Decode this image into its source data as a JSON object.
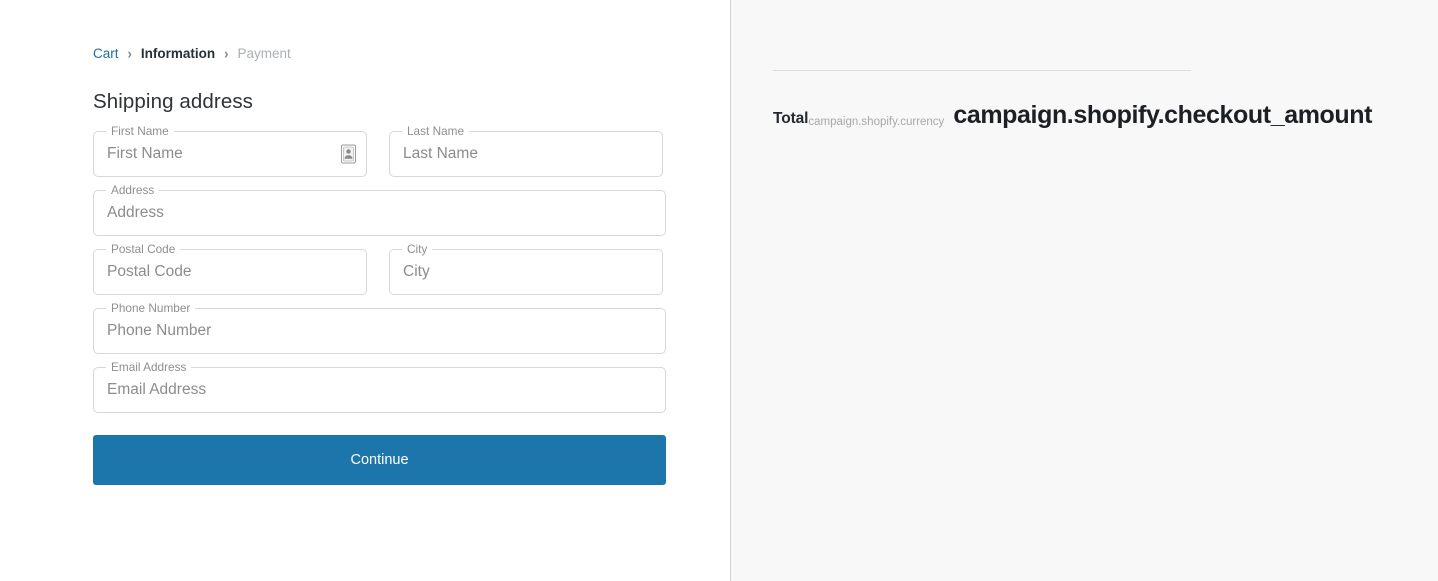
{
  "breadcrumb": {
    "separator": "›",
    "items": [
      {
        "label": "Cart",
        "state": "link"
      },
      {
        "label": "Information",
        "state": "active"
      },
      {
        "label": "Payment",
        "state": "inactive"
      }
    ]
  },
  "form": {
    "title": "Shipping address",
    "fields": [
      {
        "name": "first-name",
        "label": "First Name",
        "placeholder": "First Name",
        "value": "",
        "has_autofill_icon": true
      },
      {
        "name": "last-name",
        "label": "Last Name",
        "placeholder": "Last Name",
        "value": "",
        "has_autofill_icon": false
      },
      {
        "name": "address",
        "label": "Address",
        "placeholder": "Address",
        "value": "",
        "has_autofill_icon": false
      },
      {
        "name": "postal-code",
        "label": "Postal Code",
        "placeholder": "Postal Code",
        "value": "",
        "has_autofill_icon": false
      },
      {
        "name": "city",
        "label": "City",
        "placeholder": "City",
        "value": "",
        "has_autofill_icon": false
      },
      {
        "name": "phone-number",
        "label": "Phone Number",
        "placeholder": "Phone Number",
        "value": "",
        "has_autofill_icon": false
      },
      {
        "name": "email-address",
        "label": "Email Address",
        "placeholder": "Email Address",
        "value": "",
        "has_autofill_icon": false
      }
    ],
    "submit_label": "Continue"
  },
  "summary": {
    "total_label": "Total",
    "currency": "campaign.shopify.currency",
    "amount": "campaign.shopify.checkout_amount"
  },
  "icons": {
    "autofill": "contact-card-icon"
  },
  "colors": {
    "accent": "#1c76ac",
    "link": "#1b6ea8",
    "text_primary": "#2e3338",
    "text_muted": "#8f8f8f",
    "text_inactive": "#a9afb5",
    "field_border": "#d7d7d7",
    "panel_background": "#f8f8f8",
    "panel_divider": "#d2d2d2",
    "summary_divider": "#dedede"
  }
}
